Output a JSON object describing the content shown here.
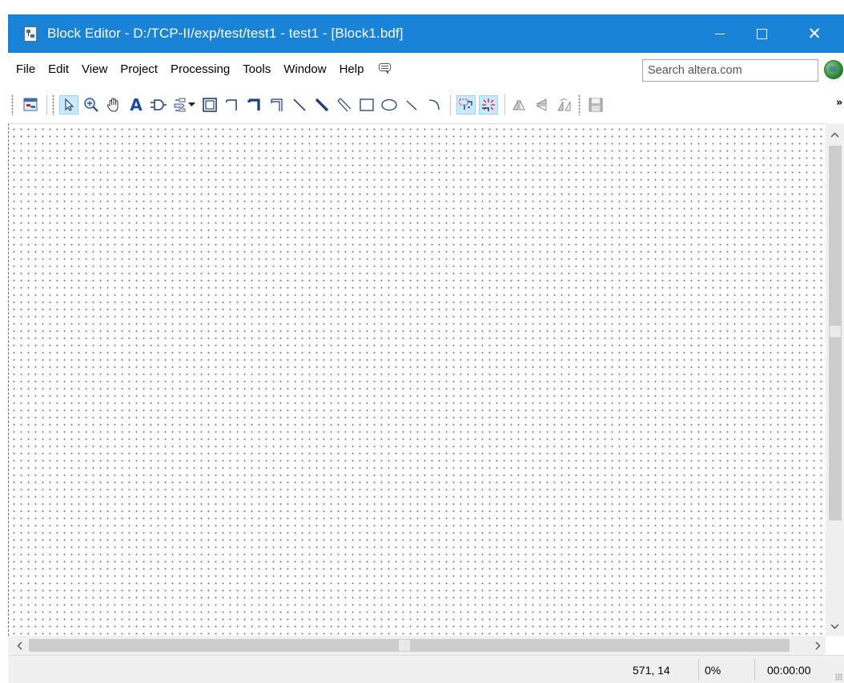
{
  "window": {
    "title": "Block Editor - D:/TCP-II/exp/test/test1 - test1 - [Block1.bdf]",
    "accent": "#1883d7"
  },
  "menu": {
    "items": [
      "File",
      "Edit",
      "View",
      "Project",
      "Processing",
      "Tools",
      "Window",
      "Help"
    ],
    "search_placeholder": "Search altera.com"
  },
  "toolbar": {
    "text_tool_label": "A",
    "overflow_label": "»",
    "icons": [
      "detach-window-icon",
      "selection-tool-icon",
      "zoom-tool-icon",
      "hand-tool-icon",
      "text-tool-icon",
      "symbol-tool-icon",
      "pin-tool-icon",
      "block-tool-icon",
      "orthogonal-node-tool-icon",
      "orthogonal-bus-tool-icon",
      "orthogonal-conduit-tool-icon",
      "diagonal-node-tool-icon",
      "diagonal-bus-tool-icon",
      "diagonal-conduit-tool-icon",
      "rectangle-tool-icon",
      "oval-tool-icon",
      "line-tool-icon",
      "arc-tool-icon",
      "rubberbanding-icon",
      "partial-line-selection-icon",
      "flip-horizontal-icon",
      "flip-vertical-icon",
      "rotate-left-icon",
      "save-icon"
    ]
  },
  "status": {
    "coordinates": "571, 14",
    "zoom_percent": "0%",
    "elapsed_time": "00:00:00"
  }
}
